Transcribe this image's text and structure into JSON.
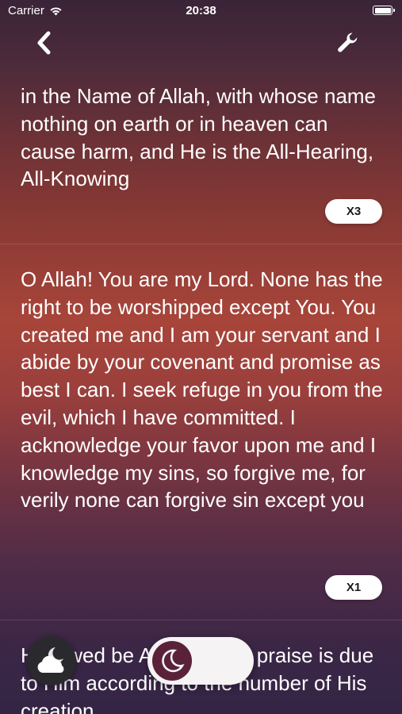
{
  "status_bar": {
    "carrier": "Carrier",
    "time": "20:38"
  },
  "nav": {
    "back_icon": "chevron-left-icon",
    "settings_icon": "wrench-icon"
  },
  "items": [
    {
      "text": "in the Name of Allah, with whose name nothing on earth or in heaven can cause harm, and He is the All-Hearing, All-Knowing",
      "count": "X3"
    },
    {
      "text": "O Allah! You are my Lord. None has the right to be worshipped except You. You created me and I am your servant and I abide by your covenant and promise as best I can. I seek refuge in you from the evil, which I have committed. I acknowledge your favor upon me and I knowledge my sins, so forgive me, for verily none can forgive sin except you",
      "count": "X1"
    },
    {
      "text": "Hallowed be Allah and all praise is due to Him according to the number of His creation"
    }
  ],
  "controls": {
    "weather_icon": "cloud-moon-icon",
    "toggle_icon": "crescent-moon-icon",
    "dark_mode": true
  },
  "colors": {
    "accent": "#5a2238",
    "pill_bg": "#ffffff"
  }
}
